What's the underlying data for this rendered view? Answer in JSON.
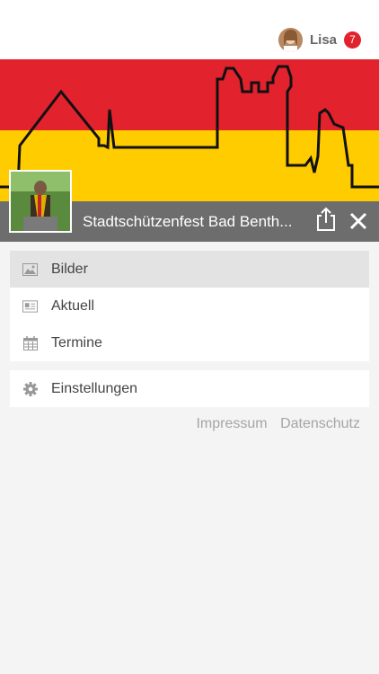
{
  "user": {
    "name": "Lisa",
    "notification_count": "7"
  },
  "header": {
    "title": "Stadtschützenfest Bad Benth..."
  },
  "menu": {
    "items": [
      {
        "label": "Bilder",
        "icon": "image-icon",
        "active": true
      },
      {
        "label": "Aktuell",
        "icon": "newspaper-icon",
        "active": false
      },
      {
        "label": "Termine",
        "icon": "calendar-icon",
        "active": false
      }
    ],
    "settings": {
      "label": "Einstellungen",
      "icon": "gear-icon"
    }
  },
  "footer": {
    "impressum": "Impressum",
    "datenschutz": "Datenschutz"
  },
  "colors": {
    "flag_red": "#e2222d",
    "flag_yellow": "#ffcc00",
    "title_bar": "#6d6d6d",
    "active_item": "#e3e3e3"
  }
}
